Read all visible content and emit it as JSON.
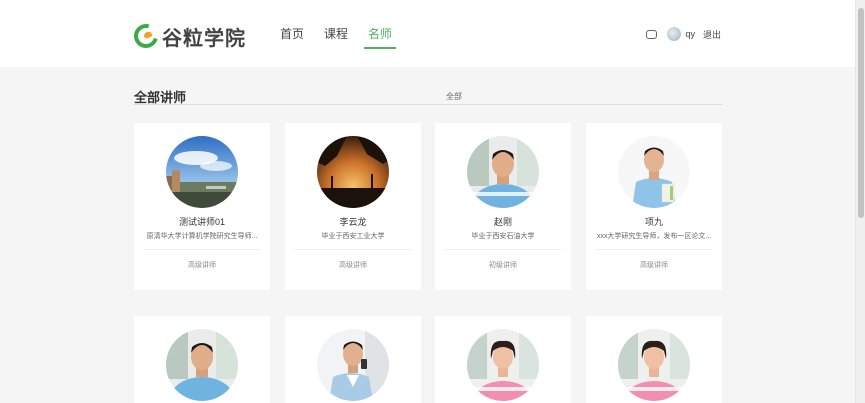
{
  "header": {
    "logo_text": "谷粒学院",
    "nav": [
      {
        "label": "首页",
        "active": false
      },
      {
        "label": "课程",
        "active": false
      },
      {
        "label": "名师",
        "active": true
      }
    ],
    "message_icon": "chat-icon",
    "username": "qy",
    "logout_label": "退出",
    "accent_color": "#4bb45e"
  },
  "section": {
    "title": "全部讲师",
    "filter_label": "全部"
  },
  "teachers": [
    {
      "name": "测试讲师01",
      "intro": "原清华大学计算机学院研究生导师...",
      "level": "高级讲师",
      "photo": "city-sky"
    },
    {
      "name": "李云龙",
      "intro": "毕业于西安工业大学",
      "level": "高级讲师",
      "photo": "sunset-trees"
    },
    {
      "name": "赵刚",
      "intro": "毕业于西安石油大学",
      "level": "初级讲师",
      "photo": "man-blue-shirt"
    },
    {
      "name": "项九",
      "intro": "xxx大学研究生导师，发布一区论文...",
      "level": "高级讲师",
      "photo": "man-holding-folder"
    },
    {
      "name": "",
      "intro": "",
      "level": "",
      "photo": "man-blue-shirt"
    },
    {
      "name": "",
      "intro": "",
      "level": "",
      "photo": "man-on-phone"
    },
    {
      "name": "",
      "intro": "",
      "level": "",
      "photo": "woman-pink-shirt"
    },
    {
      "name": "",
      "intro": "",
      "level": "",
      "photo": "woman-pink-shirt"
    }
  ]
}
